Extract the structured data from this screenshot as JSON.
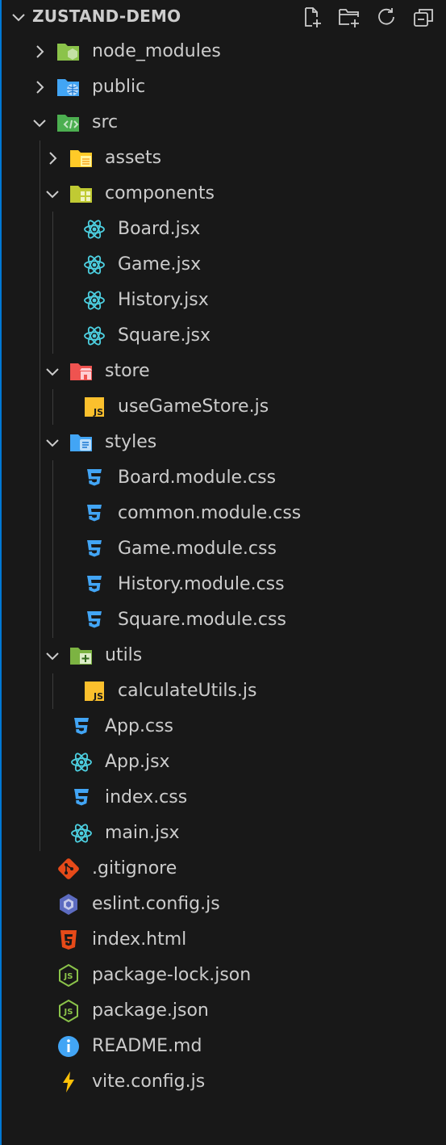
{
  "explorer": {
    "title": "ZUSTAND-DEMO",
    "actions": [
      {
        "name": "new-file-button",
        "icon": "new-file-icon"
      },
      {
        "name": "new-folder-button",
        "icon": "new-folder-icon"
      },
      {
        "name": "refresh-explorer-button",
        "icon": "refresh-icon"
      },
      {
        "name": "collapse-folders-button",
        "icon": "collapse-all-icon"
      }
    ]
  },
  "tree": [
    {
      "label": "node_modules",
      "depth": 0,
      "type": "folder",
      "expanded": false,
      "icon": "node-folder-icon"
    },
    {
      "label": "public",
      "depth": 0,
      "type": "folder",
      "expanded": false,
      "icon": "public-folder-icon"
    },
    {
      "label": "src",
      "depth": 0,
      "type": "folder",
      "expanded": true,
      "icon": "src-folder-icon"
    },
    {
      "label": "assets",
      "depth": 1,
      "type": "folder",
      "expanded": false,
      "icon": "assets-folder-icon"
    },
    {
      "label": "components",
      "depth": 1,
      "type": "folder",
      "expanded": true,
      "icon": "components-folder-icon"
    },
    {
      "label": "Board.jsx",
      "depth": 2,
      "type": "file",
      "icon": "react-icon"
    },
    {
      "label": "Game.jsx",
      "depth": 2,
      "type": "file",
      "icon": "react-icon"
    },
    {
      "label": "History.jsx",
      "depth": 2,
      "type": "file",
      "icon": "react-icon"
    },
    {
      "label": "Square.jsx",
      "depth": 2,
      "type": "file",
      "icon": "react-icon"
    },
    {
      "label": "store",
      "depth": 1,
      "type": "folder",
      "expanded": true,
      "icon": "store-folder-icon"
    },
    {
      "label": "useGameStore.js",
      "depth": 2,
      "type": "file",
      "icon": "javascript-icon"
    },
    {
      "label": "styles",
      "depth": 1,
      "type": "folder",
      "expanded": true,
      "icon": "styles-folder-icon"
    },
    {
      "label": "Board.module.css",
      "depth": 2,
      "type": "file",
      "icon": "css-icon"
    },
    {
      "label": "common.module.css",
      "depth": 2,
      "type": "file",
      "icon": "css-icon"
    },
    {
      "label": "Game.module.css",
      "depth": 2,
      "type": "file",
      "icon": "css-icon"
    },
    {
      "label": "History.module.css",
      "depth": 2,
      "type": "file",
      "icon": "css-icon"
    },
    {
      "label": "Square.module.css",
      "depth": 2,
      "type": "file",
      "icon": "css-icon"
    },
    {
      "label": "utils",
      "depth": 1,
      "type": "folder",
      "expanded": true,
      "icon": "utils-folder-icon"
    },
    {
      "label": "calculateUtils.js",
      "depth": 2,
      "type": "file",
      "icon": "javascript-icon"
    },
    {
      "label": "App.css",
      "depth": 1,
      "type": "file",
      "icon": "css-icon"
    },
    {
      "label": "App.jsx",
      "depth": 1,
      "type": "file",
      "icon": "react-icon"
    },
    {
      "label": "index.css",
      "depth": 1,
      "type": "file",
      "icon": "css-icon"
    },
    {
      "label": "main.jsx",
      "depth": 1,
      "type": "file",
      "icon": "react-icon"
    },
    {
      "label": ".gitignore",
      "depth": 0,
      "type": "file",
      "icon": "git-icon"
    },
    {
      "label": "eslint.config.js",
      "depth": 0,
      "type": "file",
      "icon": "eslint-icon"
    },
    {
      "label": "index.html",
      "depth": 0,
      "type": "file",
      "icon": "html-icon"
    },
    {
      "label": "package-lock.json",
      "depth": 0,
      "type": "file",
      "icon": "nodejs-icon"
    },
    {
      "label": "package.json",
      "depth": 0,
      "type": "file",
      "icon": "nodejs-icon"
    },
    {
      "label": "README.md",
      "depth": 0,
      "type": "file",
      "icon": "info-icon"
    },
    {
      "label": "vite.config.js",
      "depth": 0,
      "type": "file",
      "icon": "vite-icon"
    }
  ]
}
